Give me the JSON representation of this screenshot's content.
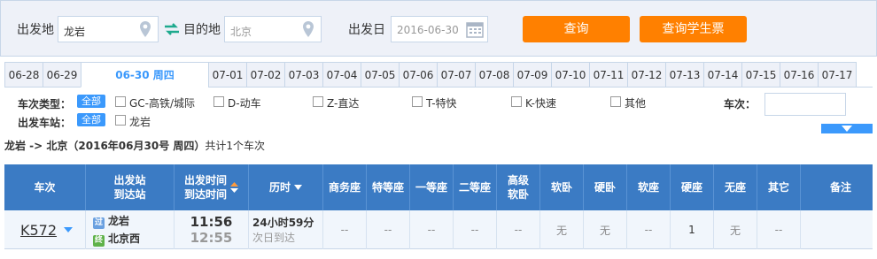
{
  "search": {
    "from_label": "出发地",
    "from_value": "龙岩",
    "to_label": "目的地",
    "to_placeholder": "北京",
    "date_label": "出发日",
    "date_value": "2016-06-30",
    "query_button": "查询",
    "student_button": "查询学生票"
  },
  "date_tabs": [
    "06-28",
    "06-29",
    "06-30 周四",
    "07-01",
    "07-02",
    "07-03",
    "07-04",
    "07-05",
    "07-06",
    "07-07",
    "07-08",
    "07-09",
    "07-10",
    "07-11",
    "07-12",
    "07-13",
    "07-14",
    "07-15",
    "07-16",
    "07-17"
  ],
  "active_tab": 2,
  "filter": {
    "type_label": "车次类型：",
    "station_label": "出发车站：",
    "all": "全部",
    "types": [
      "GC-高铁/城际",
      "D-动车",
      "Z-直达",
      "T-特快",
      "K-快速",
      "其他"
    ],
    "stations": [
      "龙岩"
    ],
    "train_no_label": "车次："
  },
  "summary": {
    "route": "龙岩 -> 北京（2016年06月30号  周四）",
    "count": "共计1个车次"
  },
  "table": {
    "headers": [
      "车次",
      "出发站\n到达站",
      "出发时间\n到达时间",
      "历时",
      "商务座",
      "特等座",
      "一等座",
      "二等座",
      "高级\n软卧",
      "软卧",
      "硬卧",
      "软座",
      "硬座",
      "无座",
      "其它",
      "备注"
    ],
    "rows": [
      {
        "train": "K572",
        "from_station": "龙岩",
        "to_station": "北京西",
        "from_badge": "过",
        "to_badge": "终",
        "depart": "11:56",
        "arrive": "12:55",
        "duration": "24小时59分",
        "arrive_day": "次日到达",
        "seats": [
          "--",
          "--",
          "--",
          "--",
          "--",
          "无",
          "无",
          "--",
          "1",
          "无",
          "--",
          ""
        ]
      }
    ]
  },
  "colors": {
    "accent": "#3b99fc",
    "orange": "#ff8000",
    "header": "#3b7bc4"
  }
}
